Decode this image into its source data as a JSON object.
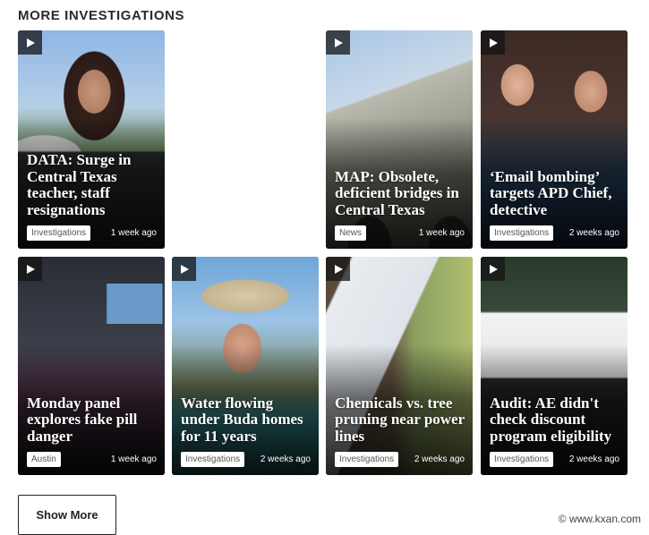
{
  "section": {
    "title": "MORE INVESTIGATIONS"
  },
  "cards": [
    {
      "headline": "DATA: Surge in Central Texas teacher, staff resignations",
      "tag": "Investigations",
      "time": "1 week ago",
      "icon": "play-icon"
    },
    {
      "headline": "MAP: Obsolete, deficient bridges in Central Texas",
      "tag": "News",
      "time": "1 week ago",
      "icon": "play-icon"
    },
    {
      "headline": "‘Email bombing’ targets APD Chief, detective",
      "tag": "Investigations",
      "time": "2 weeks ago",
      "icon": "play-icon"
    },
    {
      "headline": "Monday panel explores fake pill danger",
      "tag": "Austin",
      "time": "1 week ago",
      "icon": "play-icon"
    },
    {
      "headline": "Water flowing under Buda homes for 11 years",
      "tag": "Investigations",
      "time": "2 weeks ago",
      "icon": "play-icon"
    },
    {
      "headline": "Chemicals vs. tree pruning near power lines",
      "tag": "Investigations",
      "time": "2 weeks ago",
      "icon": "play-icon"
    },
    {
      "headline": "Audit: AE didn't check discount program eligibility",
      "tag": "Investigations",
      "time": "2 weeks ago",
      "icon": "play-icon"
    }
  ],
  "show_more": {
    "label": "Show More"
  },
  "watermark": {
    "text": "© www.kxan.com"
  }
}
